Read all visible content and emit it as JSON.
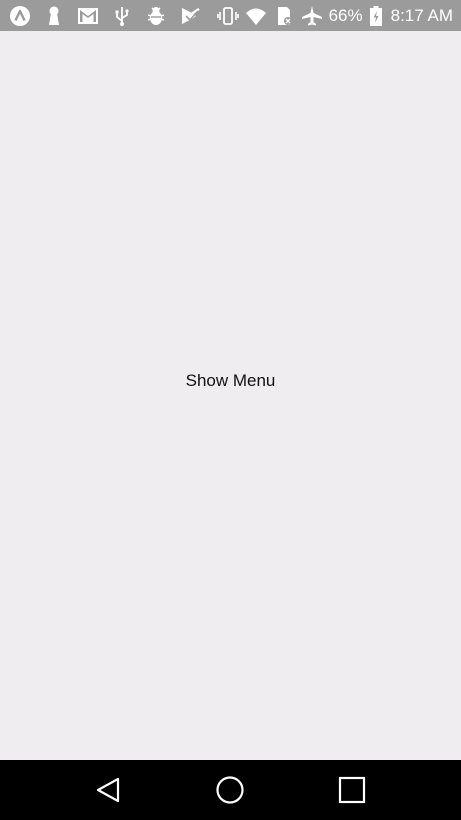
{
  "status_bar": {
    "battery_percent": "66%",
    "time": "8:17 AM",
    "left_icons": [
      "app-a-icon",
      "keyhole-icon",
      "gmail-icon",
      "usb-icon",
      "bug-icon",
      "play-store-icon"
    ],
    "right_icons": [
      "vibrate-icon",
      "wifi-icon",
      "sd-card-icon",
      "airplane-icon",
      "battery-charging-icon"
    ],
    "colors": {
      "background": "#9b9b9b",
      "foreground": "#ffffff"
    }
  },
  "main": {
    "show_menu_label": "Show Menu",
    "background": "#efedef"
  },
  "nav_bar": {
    "buttons": [
      "back-icon",
      "home-icon",
      "recents-icon"
    ],
    "background": "#000000"
  }
}
